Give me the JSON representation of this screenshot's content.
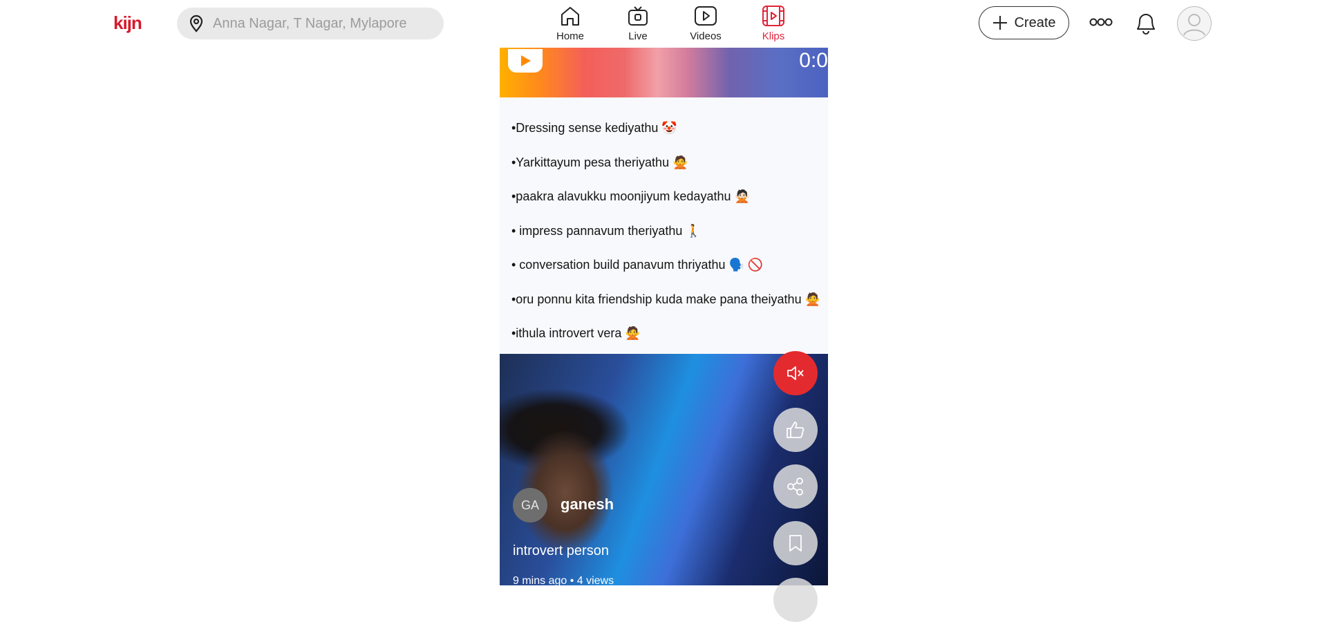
{
  "header": {
    "logo_text": "kijn",
    "search_placeholder": "Anna Nagar, T Nagar, Mylapore",
    "nav": [
      {
        "label": "Home",
        "icon": "home-icon",
        "active": false
      },
      {
        "label": "Live",
        "icon": "live-tv-icon",
        "active": false
      },
      {
        "label": "Videos",
        "icon": "play-square-icon",
        "active": false
      },
      {
        "label": "Klips",
        "icon": "film-strip-icon",
        "active": true
      }
    ],
    "create_label": "Create"
  },
  "video": {
    "timecode": "0:0",
    "text_lines": [
      "•Dressing sense kediyathu 🤡",
      "•Yarkittayum pesa theriyathu 🙅",
      "•paakra alavukku moonjiyum kedayathu 🙅🏻",
      "• impress pannavum theriyathu 🚶",
      "• conversation build panavum thriyathu 🗣️ 🚫",
      "•oru ponnu kita friendship kuda make pana theiyathu 🙅",
      "•ithula introvert vera 🙅"
    ],
    "channel": {
      "initials": "GA",
      "name": "ganesh"
    },
    "caption": "introvert person",
    "meta": "9 mins ago • 4 views"
  },
  "actions": [
    "mute-icon",
    "thumbs-up-icon",
    "share-icon",
    "bookmark-icon"
  ],
  "colors": {
    "brand": "#d7192b",
    "active_nav": "#e0243a",
    "mute_bg": "#e32b2f"
  }
}
